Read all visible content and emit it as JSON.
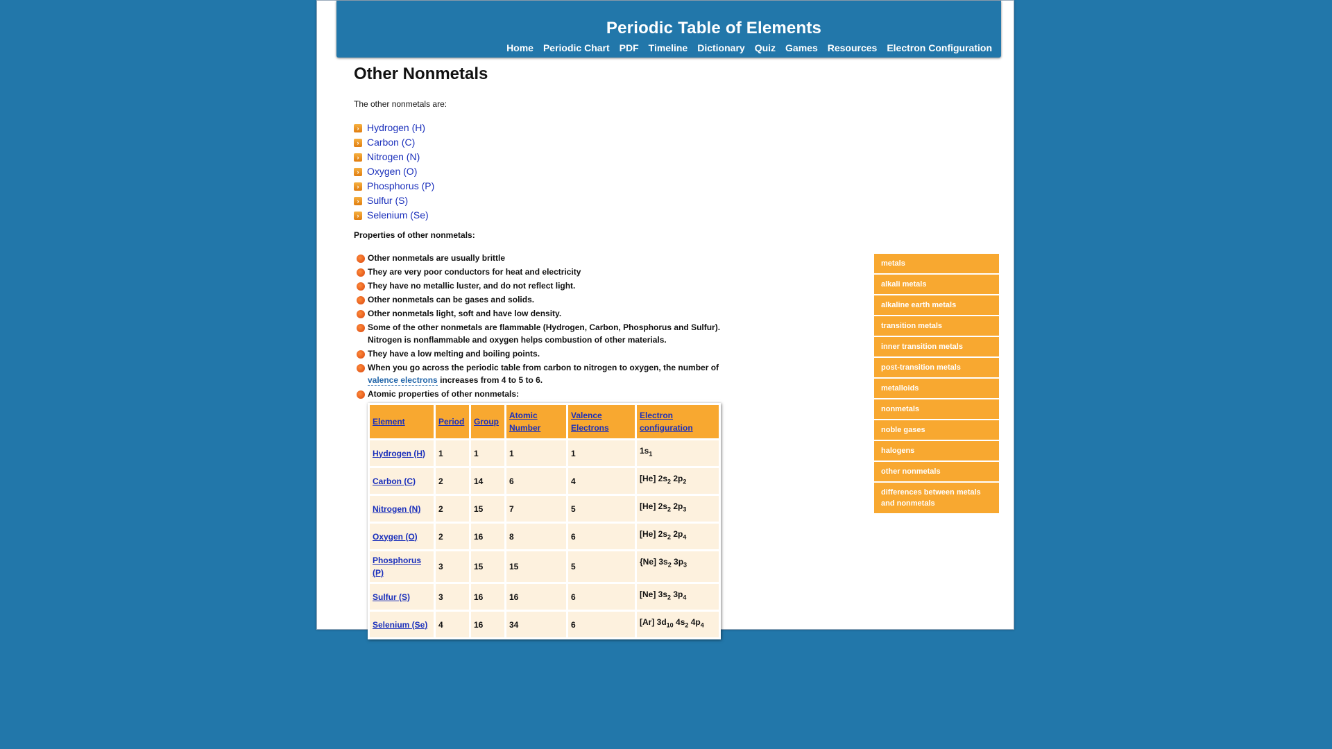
{
  "site_title": "Periodic Table of Elements",
  "nav": [
    "Home",
    "Periodic Chart",
    "PDF",
    "Timeline",
    "Dictionary",
    "Quiz",
    "Games",
    "Resources",
    "Electron Configuration"
  ],
  "page_title": "Other Nonmetals",
  "intro": "The other nonmetals are:",
  "element_links": [
    "Hydrogen (H)",
    "Carbon (C)",
    "Nitrogen (N)",
    "Oxygen (O)",
    "Phosphorus (P)",
    "Sulfur (S)",
    "Selenium (Se)"
  ],
  "properties_title": "Properties of other nonmetals:",
  "properties": [
    "Other nonmetals are usually brittle",
    "They are very poor conductors for heat and electricity",
    "They have no metallic luster, and do not reflect light.",
    "Other nonmetals can be gases and solids.",
    "Other nonmetals light, soft and have low density.",
    "Some of the other nonmetals are flammable (Hydrogen, Carbon, Phosphorus and Sulfur). Nitrogen is nonflammable and oxygen helps combustion of other materials.",
    "They have a low melting and boiling points."
  ],
  "valence_item": {
    "before": "When you go across the periodic table from carbon to nitrogen to oxygen, the number of",
    "link": "valence electrons",
    "after": "increases from 4 to 5 to 6."
  },
  "atomic_props_label": "Atomic properties of other nonmetals:",
  "table": {
    "headers": [
      "Element",
      "Period",
      "Group",
      "Atomic Number",
      "Valence Electrons",
      "Electron configuration"
    ],
    "rows": [
      {
        "element": "Hydrogen (H)",
        "period": "1",
        "group": "1",
        "atomic_number": "1",
        "valence": "1",
        "config": [
          [
            "1s",
            "1"
          ]
        ]
      },
      {
        "element": "Carbon (C)",
        "period": "2",
        "group": "14",
        "atomic_number": "6",
        "valence": "4",
        "config": [
          [
            "[He] 2s",
            "2"
          ],
          [
            " 2p",
            "2"
          ]
        ]
      },
      {
        "element": "Nitrogen (N)",
        "period": "2",
        "group": "15",
        "atomic_number": "7",
        "valence": "5",
        "config": [
          [
            "[He] 2s",
            "2"
          ],
          [
            " 2p",
            "3"
          ]
        ]
      },
      {
        "element": "Oxygen (O)",
        "period": "2",
        "group": "16",
        "atomic_number": "8",
        "valence": "6",
        "config": [
          [
            "[He] 2s",
            "2"
          ],
          [
            " 2p",
            "4"
          ]
        ]
      },
      {
        "element": "Phosphorus (P)",
        "period": "3",
        "group": "15",
        "atomic_number": "15",
        "valence": "5",
        "config": [
          [
            "{Ne] 3s",
            "2"
          ],
          [
            " 3p",
            "3"
          ]
        ]
      },
      {
        "element": "Sulfur (S)",
        "period": "3",
        "group": "16",
        "atomic_number": "16",
        "valence": "6",
        "config": [
          [
            "[Ne] 3s",
            "2"
          ],
          [
            " 3p",
            "4"
          ]
        ]
      },
      {
        "element": "Selenium (Se)",
        "period": "4",
        "group": "16",
        "atomic_number": "34",
        "valence": "6",
        "config": [
          [
            "[Ar] 3d",
            "10"
          ],
          [
            " 4s",
            "2"
          ],
          [
            " 4p",
            "4"
          ]
        ]
      }
    ]
  },
  "sidebar": [
    "metals",
    "alkali metals",
    "alkaline earth metals",
    "transition metals",
    "inner transition metals",
    "post-transition metals",
    "metalloids",
    "nonmetals",
    "noble gases",
    "halogens",
    "other nonmetals",
    "differences between metals and nonmetals"
  ]
}
